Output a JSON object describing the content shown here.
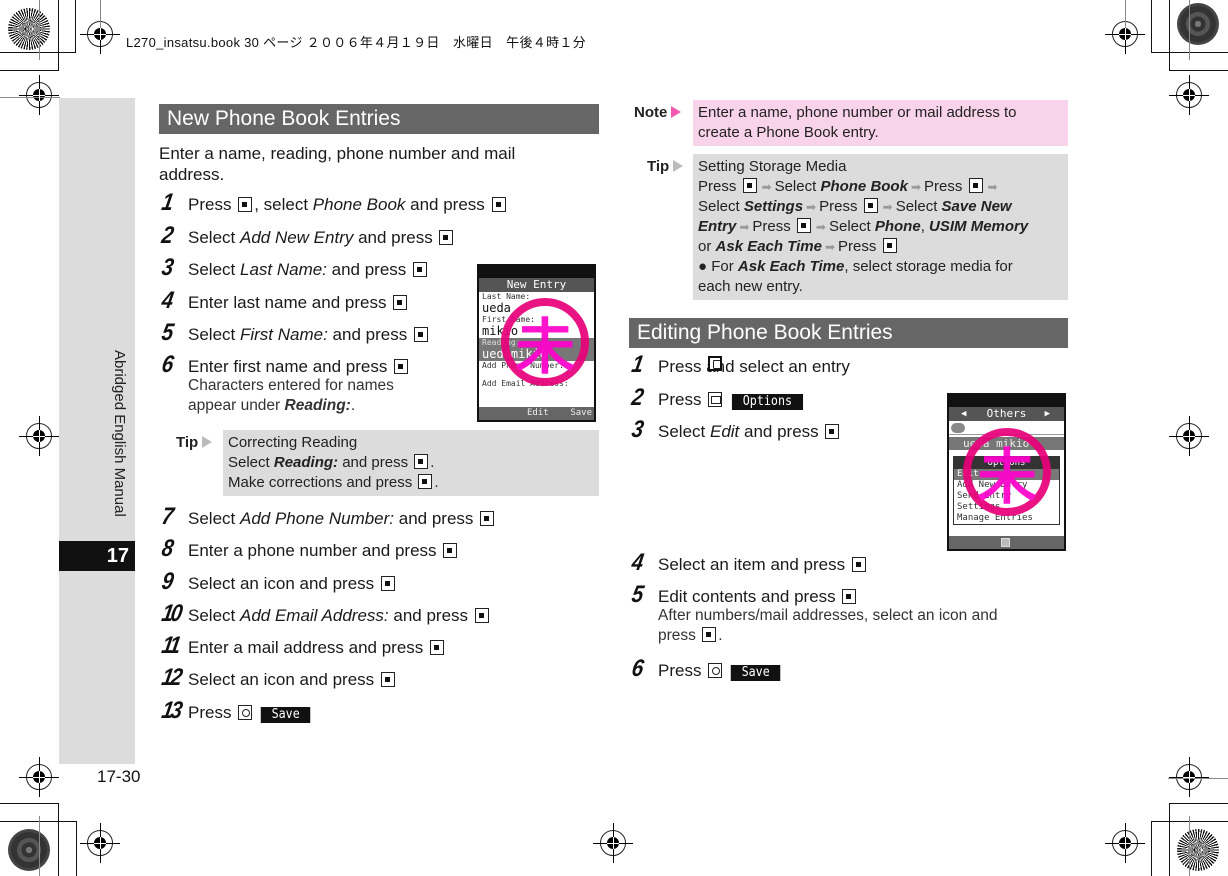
{
  "slug": "L270_insatsu.book  30 ページ  ２００６年４月１９日　水曜日　午後４時１分",
  "sidebar": {
    "label": "Abridged English Manual",
    "chapter": "17"
  },
  "page_number": "17-30",
  "left": {
    "section_title": "New Phone Book Entries",
    "intro": "Enter a name, reading, phone number and mail address.",
    "steps": [
      {
        "num": "1",
        "parts": [
          "Press ",
          "[center-key]",
          ", select ",
          "{Phone Book}",
          " and press ",
          "[center-key]"
        ]
      },
      {
        "num": "2",
        "parts": [
          "Select ",
          "{Add New Entry}",
          " and press ",
          "[center-key]"
        ]
      },
      {
        "num": "3",
        "parts": [
          "Select ",
          "{Last Name:}",
          " and press ",
          "[center-key]"
        ]
      },
      {
        "num": "4",
        "parts": [
          "Enter last name and press ",
          "[center-key]"
        ]
      },
      {
        "num": "5",
        "parts": [
          "Select ",
          "{First Name:}",
          " and press ",
          "[center-key]"
        ]
      },
      {
        "num": "6",
        "parts": [
          "Enter first name and press ",
          "[center-key]"
        ],
        "sub": [
          "Characters entered for names",
          "appear under |Reading:|."
        ]
      },
      {
        "num": "7",
        "parts": [
          "Select ",
          "{Add Phone Number:}",
          " and press ",
          "[center-key]"
        ]
      },
      {
        "num": "8",
        "parts": [
          "Enter a phone number and press ",
          "[center-key]"
        ]
      },
      {
        "num": "9",
        "parts": [
          "Select an icon and press ",
          "[center-key]"
        ]
      },
      {
        "num": "10",
        "parts": [
          "Select ",
          "{Add Email Address:}",
          " and press ",
          "[center-key]"
        ]
      },
      {
        "num": "11",
        "parts": [
          "Enter a mail address and press ",
          "[center-key]"
        ]
      },
      {
        "num": "12",
        "parts": [
          "Select an icon and press ",
          "[center-key]"
        ]
      },
      {
        "num": "13",
        "parts": [
          "Press ",
          "[circle-key]",
          "<Save>"
        ]
      }
    ],
    "tip": {
      "label": "Tip",
      "title": "Correcting Reading",
      "lines": [
        [
          "Select ",
          "|Reading:|",
          " and press ",
          "[center-key]",
          "."
        ],
        [
          "Make corrections and press ",
          "[center-key]",
          "."
        ]
      ]
    },
    "phone_screen": {
      "title": "New Entry",
      "fields": [
        {
          "label": "Last Name:",
          "value": "ueda"
        },
        {
          "label": "First Name:",
          "value": "mikio"
        },
        {
          "label": "Reading:",
          "value": "uedamikio",
          "highlighted": true
        },
        {
          "label": "Add Phone Number:",
          "value": ""
        },
        {
          "label": "Add Email Address:",
          "value": ""
        }
      ],
      "softkeys": {
        "center": "Edit",
        "right": "Save"
      },
      "stamp": "未"
    }
  },
  "right": {
    "note": {
      "label": "Note",
      "text": [
        "Enter a name, phone number or mail address to",
        "create a Phone Book entry."
      ]
    },
    "tip": {
      "label": "Tip",
      "title": "Setting Storage Media",
      "lines": [
        [
          "Press ",
          "[center-key]",
          "(arrow)",
          "Select ",
          "|Phone Book|",
          "(arrow)",
          "Press ",
          "[center-key]",
          "(arrow)"
        ],
        [
          "Select ",
          "|Settings|",
          "(arrow)",
          "Press ",
          "[center-key]",
          "(arrow)",
          "Select ",
          "|Save New|"
        ],
        [
          "|Entry|",
          "(arrow)",
          "Press ",
          "[center-key]",
          "(arrow)",
          "Select ",
          "|Phone|",
          ", ",
          "|USIM Memory|"
        ],
        [
          "or ",
          "|Ask Each Time|",
          "(arrow)",
          "Press ",
          "[center-key]"
        ],
        [
          "● For ",
          "|Ask Each Time|",
          ", select storage media for"
        ],
        [
          "   each new entry."
        ]
      ]
    },
    "section_title": "Editing Phone Book Entries",
    "steps": [
      {
        "num": "1",
        "parts": [
          "Press ",
          "[phone-key]",
          " and select an entry"
        ]
      },
      {
        "num": "2",
        "parts": [
          "Press ",
          "[mail-key]",
          "<Options>"
        ]
      },
      {
        "num": "3",
        "parts": [
          "Select ",
          "{Edit}",
          " and press ",
          "[center-key]"
        ]
      },
      {
        "num": "4",
        "parts": [
          "Select an item and press ",
          "[center-key]"
        ]
      },
      {
        "num": "5",
        "parts": [
          "Edit contents and press ",
          "[center-key]"
        ],
        "sub": [
          "After numbers/mail addresses, select an icon and",
          "press [center-key]."
        ]
      },
      {
        "num": "6",
        "parts": [
          "Press ",
          "[circle-key]",
          "<Save>"
        ]
      }
    ],
    "phone_screen": {
      "title": "Others",
      "entry": "ueda mikio",
      "menu_title": "Options",
      "menu_items": [
        "Edit",
        "Add New Entry",
        "Send Entry",
        "Settings",
        "Manage Entries"
      ],
      "selected_index": 0,
      "stamp": "未"
    }
  }
}
